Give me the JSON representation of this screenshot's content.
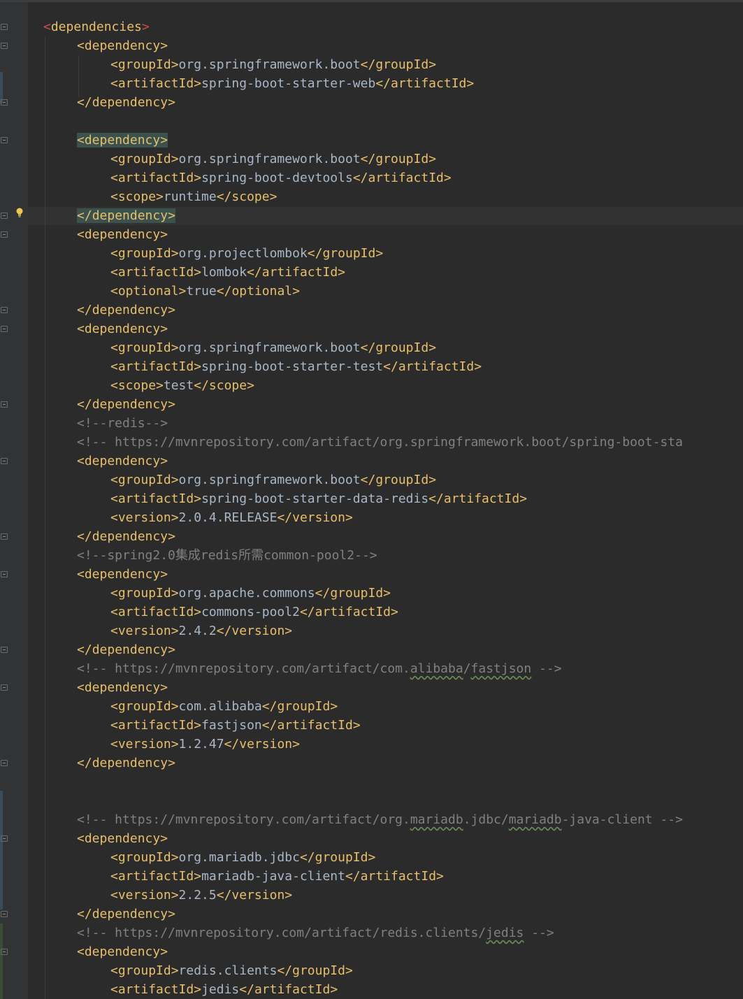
{
  "editor": {
    "colors": {
      "background": "#2b2b2b",
      "gutter": "#313335",
      "tag": "#e8bf6a",
      "text": "#a9b7c6",
      "comment": "#808080",
      "root_bracket": "#cc4b4b",
      "bracket_match_highlight": "#3b514d",
      "caret_row": "#323232"
    },
    "lines": [
      {
        "type": "open",
        "tag": "dependencies"
      },
      {
        "type": "open",
        "tag": "dependency"
      },
      {
        "type": "element",
        "tag": "groupId",
        "value": "org.springframework.boot"
      },
      {
        "type": "element",
        "tag": "artifactId",
        "value": "spring-boot-starter-web"
      },
      {
        "type": "close",
        "tag": "dependency"
      },
      {
        "type": "blank"
      },
      {
        "type": "open",
        "tag": "dependency"
      },
      {
        "type": "element",
        "tag": "groupId",
        "value": "org.springframework.boot"
      },
      {
        "type": "element",
        "tag": "artifactId",
        "value": "spring-boot-devtools"
      },
      {
        "type": "element",
        "tag": "scope",
        "value": "runtime"
      },
      {
        "type": "close",
        "tag": "dependency"
      },
      {
        "type": "open",
        "tag": "dependency"
      },
      {
        "type": "element",
        "tag": "groupId",
        "value": "org.projectlombok"
      },
      {
        "type": "element",
        "tag": "artifactId",
        "value": "lombok"
      },
      {
        "type": "element",
        "tag": "optional",
        "value": "true"
      },
      {
        "type": "close",
        "tag": "dependency"
      },
      {
        "type": "open",
        "tag": "dependency"
      },
      {
        "type": "element",
        "tag": "groupId",
        "value": "org.springframework.boot"
      },
      {
        "type": "element",
        "tag": "artifactId",
        "value": "spring-boot-starter-test"
      },
      {
        "type": "element",
        "tag": "scope",
        "value": "test"
      },
      {
        "type": "close",
        "tag": "dependency"
      },
      {
        "type": "comment",
        "text": "<!--redis-->"
      },
      {
        "type": "comment",
        "text": "<!-- https://mvnrepository.com/artifact/org.springframework.boot/spring-boot-sta"
      },
      {
        "type": "open",
        "tag": "dependency"
      },
      {
        "type": "element",
        "tag": "groupId",
        "value": "org.springframework.boot"
      },
      {
        "type": "element",
        "tag": "artifactId",
        "value": "spring-boot-starter-data-redis"
      },
      {
        "type": "element",
        "tag": "version",
        "value": "2.0.4.RELEASE"
      },
      {
        "type": "close",
        "tag": "dependency"
      },
      {
        "type": "comment",
        "text": "<!--spring2.0集成redis所需common-pool2-->"
      },
      {
        "type": "open",
        "tag": "dependency"
      },
      {
        "type": "element",
        "tag": "groupId",
        "value": "org.apache.commons"
      },
      {
        "type": "element",
        "tag": "artifactId",
        "value": "commons-pool2"
      },
      {
        "type": "element",
        "tag": "version",
        "value": "2.4.2"
      },
      {
        "type": "close",
        "tag": "dependency"
      },
      {
        "type": "comment",
        "text": "<!-- https://mvnrepository.com/artifact/com.alibaba/fastjson -->"
      },
      {
        "type": "open",
        "tag": "dependency"
      },
      {
        "type": "element",
        "tag": "groupId",
        "value": "com.alibaba"
      },
      {
        "type": "element",
        "tag": "artifactId",
        "value": "fastjson"
      },
      {
        "type": "element",
        "tag": "version",
        "value": "1.2.47"
      },
      {
        "type": "close",
        "tag": "dependency"
      },
      {
        "type": "blank"
      },
      {
        "type": "blank"
      },
      {
        "type": "comment",
        "text": "<!-- https://mvnrepository.com/artifact/org.mariadb.jdbc/mariadb-java-client -->"
      },
      {
        "type": "open",
        "tag": "dependency"
      },
      {
        "type": "element",
        "tag": "groupId",
        "value": "org.mariadb.jdbc"
      },
      {
        "type": "element",
        "tag": "artifactId",
        "value": "mariadb-java-client"
      },
      {
        "type": "element",
        "tag": "version",
        "value": "2.2.5"
      },
      {
        "type": "close",
        "tag": "dependency"
      },
      {
        "type": "comment",
        "text": "<!-- https://mvnrepository.com/artifact/redis.clients/jedis -->"
      },
      {
        "type": "open",
        "tag": "dependency"
      },
      {
        "type": "element",
        "tag": "groupId",
        "value": "redis.clients"
      },
      {
        "type": "element",
        "tag": "artifactId",
        "value": "jedis"
      }
    ],
    "gutter_icons": [
      "lightbulb-icon",
      "fold-icon"
    ]
  }
}
